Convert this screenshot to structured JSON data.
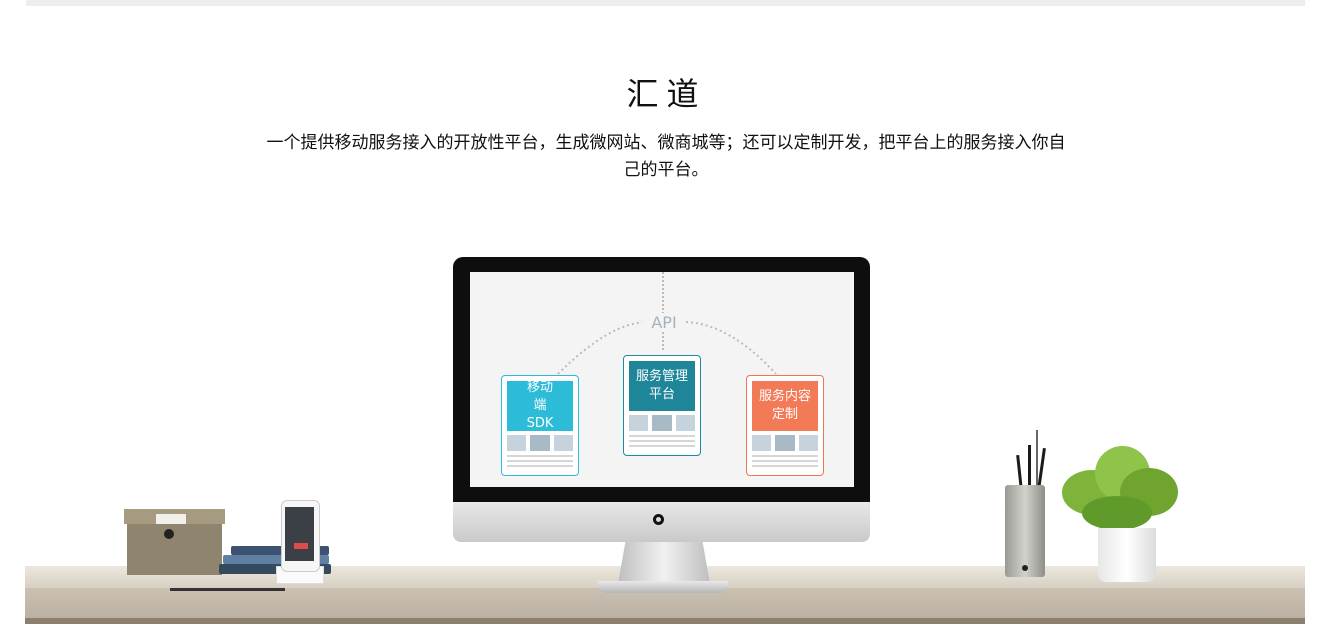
{
  "title": "汇道",
  "description": "一个提供移动服务接入的开放性平台，生成微网站、微商城等；还可以定制开发，把平台上的服务接入你自己的平台。",
  "diagram": {
    "api_label": "API",
    "cards": [
      {
        "label": "移动端SDK",
        "color": "#2dbcd8"
      },
      {
        "label": "服务管理平台",
        "color": "#1f8598"
      },
      {
        "label": "服务内容定制",
        "color": "#f27a56"
      }
    ]
  },
  "colors": {
    "background": "#ffffff",
    "desk": "#d7cfc2",
    "screen": "#f4f4f4"
  }
}
